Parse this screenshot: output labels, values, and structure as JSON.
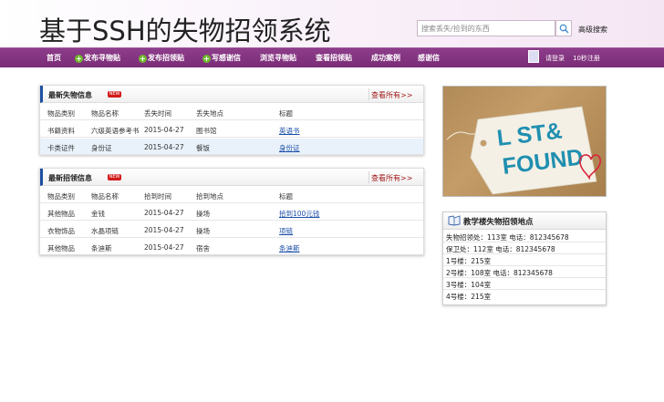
{
  "header": {
    "site_title": "基于SSH的失物招领系统",
    "search_placeholder": "搜索丢失/捡到的东西",
    "advanced_search": "高级搜索"
  },
  "nav": {
    "items": [
      {
        "label": "首页",
        "plus": false
      },
      {
        "label": "发布寻物贴",
        "plus": true
      },
      {
        "label": "发布招领贴",
        "plus": true
      },
      {
        "label": "写感谢信",
        "plus": true
      },
      {
        "label": "浏览寻物贴",
        "plus": false
      },
      {
        "label": "查看招领贴",
        "plus": false
      },
      {
        "label": "成功案例",
        "plus": false
      },
      {
        "label": "感谢信",
        "plus": false
      }
    ],
    "login": "请登录",
    "register": "10秒注册"
  },
  "lost_panel": {
    "title": "最新失物信息",
    "badge": "NEW",
    "more": "查看所有>>",
    "headers": [
      "物品类别",
      "物品名称",
      "丢失时间",
      "丢失地点",
      "标题"
    ],
    "rows": [
      [
        "书籍资料",
        "六级英语参考书",
        "2015-04-27",
        "图书馆",
        "英语书"
      ],
      [
        "卡类证件",
        "身份证",
        "2015-04-27",
        "餐饭",
        "身份证"
      ]
    ]
  },
  "found_panel": {
    "title": "最新招领信息",
    "badge": "NEW",
    "more": "查看所有>>",
    "headers": [
      "物品类别",
      "物品名称",
      "拾到时间",
      "拾到地点",
      "标题"
    ],
    "rows": [
      [
        "其他物品",
        "金钱",
        "2015-04-27",
        "操场",
        "拾到100元钱"
      ],
      [
        "衣物饰品",
        "水晶项链",
        "2015-04-27",
        "操场",
        "项链"
      ],
      [
        "其他物品",
        "条迪斯",
        "2015-04-27",
        "宿舍",
        "条迪斯"
      ]
    ]
  },
  "photo": {
    "line1": "L  ST&",
    "line2": "FOUND",
    "heart_color": "#d9253b",
    "text_color": "#1f8fb0"
  },
  "info_box": {
    "title": "教学楼失物招领地点",
    "lines": [
      "失物招领处：113室      电话：812345678",
      "保卫处：112室      电话：812345678",
      "1号楼：215室",
      "2号楼：108室      电话：812345678",
      "3号楼：104室",
      "4号楼：215室"
    ]
  },
  "colors": {
    "nav_bg": "#7d2f7a",
    "accent_blue": "#1e4fa0",
    "more_red": "#a01818",
    "plus_green": "#6fb82e"
  }
}
